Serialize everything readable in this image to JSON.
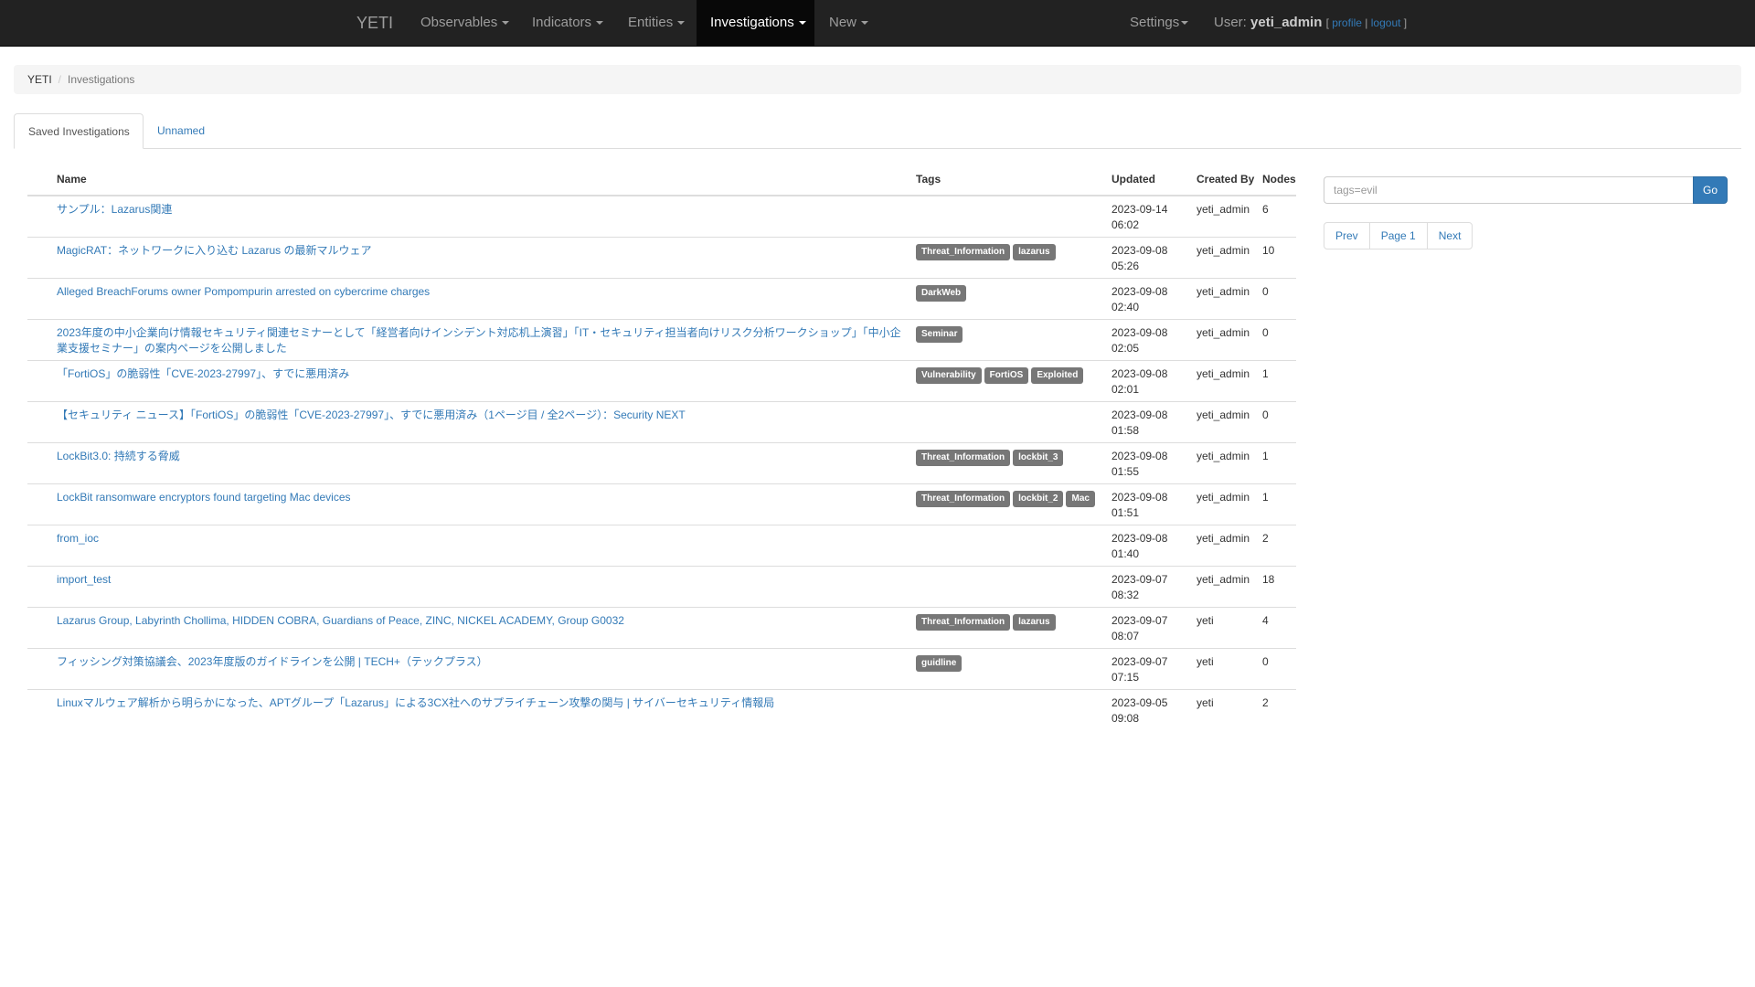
{
  "navbar": {
    "brand": "YETI",
    "items": [
      {
        "label": "Observables",
        "dropdown": true
      },
      {
        "label": "Indicators",
        "dropdown": true
      },
      {
        "label": "Entities",
        "dropdown": true
      },
      {
        "label": "Investigations",
        "dropdown": true,
        "active": true
      },
      {
        "label": "New",
        "dropdown": true
      }
    ],
    "settings": "Settings",
    "user_prefix": "User:",
    "username": "yeti_admin",
    "profile": "profile",
    "logout": "logout",
    "bracket_open": "[",
    "bracket_sep": "|",
    "bracket_close": "]"
  },
  "breadcrumb": {
    "home": "YETI",
    "separator": "/",
    "current": "Investigations"
  },
  "tabs": [
    {
      "label": "Saved Investigations",
      "active": true
    },
    {
      "label": "Unnamed",
      "active": false
    }
  ],
  "table": {
    "columns": {
      "name": "Name",
      "tags": "Tags",
      "updated": "Updated",
      "created_by": "Created By",
      "nodes": "Nodes"
    },
    "rows": [
      {
        "name": "サンプル：Lazarus関連",
        "tags": [],
        "date": "2023-09-14",
        "time": "06:02",
        "created_by": "yeti_admin",
        "nodes": "6"
      },
      {
        "name": "MagicRAT：ネットワークに入り込む Lazarus の最新マルウェア",
        "tags": [
          "Threat_Information",
          "lazarus"
        ],
        "date": "2023-09-08",
        "time": "05:26",
        "created_by": "yeti_admin",
        "nodes": "10"
      },
      {
        "name": "Alleged BreachForums owner Pompompurin arrested on cybercrime charges",
        "tags": [
          "DarkWeb"
        ],
        "date": "2023-09-08",
        "time": "02:40",
        "created_by": "yeti_admin",
        "nodes": "0"
      },
      {
        "name": "2023年度の中小企業向け情報セキュリティ関連セミナーとして「経営者向けインシデント対応机上演習」「IT・セキュリティ担当者向けリスク分析ワークショップ」「中小企業支援セミナー」の案内ページを公開しました",
        "tags": [
          "Seminar"
        ],
        "date": "2023-09-08",
        "time": "02:05",
        "created_by": "yeti_admin",
        "nodes": "0"
      },
      {
        "name": "「FortiOS」の脆弱性「CVE-2023-27997」、すでに悪用済み",
        "tags": [
          "Vulnerability",
          "FortiOS",
          "Exploited"
        ],
        "date": "2023-09-08",
        "time": "02:01",
        "created_by": "yeti_admin",
        "nodes": "1"
      },
      {
        "name": "【セキュリティ ニュース】「FortiOS」の脆弱性「CVE-2023-27997」、すでに悪用済み（1ページ目 / 全2ページ）：Security NEXT",
        "tags": [],
        "date": "2023-09-08",
        "time": "01:58",
        "created_by": "yeti_admin",
        "nodes": "0"
      },
      {
        "name": "LockBit3.0: 持続する脅威",
        "tags": [
          "Threat_Information",
          "lockbit_3"
        ],
        "date": "2023-09-08",
        "time": "01:55",
        "created_by": "yeti_admin",
        "nodes": "1"
      },
      {
        "name": "LockBit ransomware encryptors found targeting Mac devices",
        "tags": [
          "Threat_Information",
          "lockbit_2",
          "Mac"
        ],
        "date": "2023-09-08",
        "time": "01:51",
        "created_by": "yeti_admin",
        "nodes": "1"
      },
      {
        "name": "from_ioc",
        "tags": [],
        "date": "2023-09-08",
        "time": "01:40",
        "created_by": "yeti_admin",
        "nodes": "2"
      },
      {
        "name": "import_test",
        "tags": [],
        "date": "2023-09-07",
        "time": "08:32",
        "created_by": "yeti_admin",
        "nodes": "18"
      },
      {
        "name": "Lazarus Group, Labyrinth Chollima, HIDDEN COBRA, Guardians of Peace, ZINC, NICKEL ACADEMY, Group G0032",
        "tags": [
          "Threat_Information",
          "lazarus"
        ],
        "date": "2023-09-07",
        "time": "08:07",
        "created_by": "yeti",
        "nodes": "4"
      },
      {
        "name": "フィッシング対策協議会、2023年度版のガイドラインを公開 | TECH+（テックプラス）",
        "tags": [
          "guidline"
        ],
        "date": "2023-09-07",
        "time": "07:15",
        "created_by": "yeti",
        "nodes": "0"
      },
      {
        "name": "Linuxマルウェア解析から明らかになった、APTグループ「Lazarus」による3CX社へのサプライチェーン攻撃の関与 | サイバーセキュリティ情報局",
        "tags": [],
        "date": "2023-09-05",
        "time": "09:08",
        "created_by": "yeti",
        "nodes": "2"
      }
    ]
  },
  "search": {
    "placeholder": "tags=evil",
    "value": "",
    "go_label": "Go"
  },
  "pager": {
    "prev": "Prev",
    "page": "Page 1",
    "next": "Next"
  }
}
